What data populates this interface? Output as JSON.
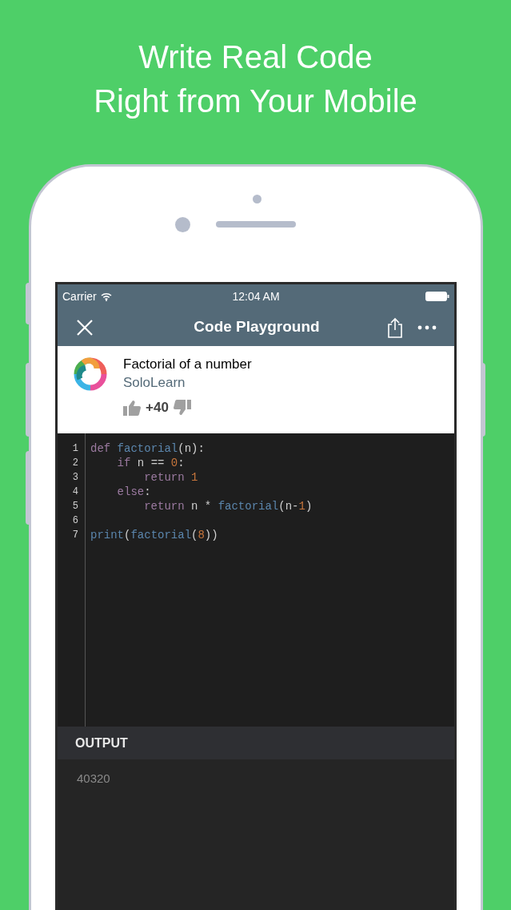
{
  "headline": [
    "Write Real Code",
    "Right from Your Mobile"
  ],
  "status_bar": {
    "carrier": "Carrier",
    "time": "12:04 AM"
  },
  "nav": {
    "title": "Code Playground"
  },
  "code_info": {
    "title": "Factorial of a number",
    "author": "SoloLearn",
    "votes": "+40"
  },
  "editor": {
    "lines": [
      {
        "number": "1",
        "tokens": [
          {
            "text": "def",
            "kind": "keyword"
          },
          {
            "text": " factorial",
            "kind": "function"
          },
          {
            "text": "(n):",
            "kind": "plain"
          }
        ]
      },
      {
        "number": "2",
        "tokens": [
          {
            "text": "    if",
            "kind": "keyword"
          },
          {
            "text": " n == ",
            "kind": "plain"
          },
          {
            "text": "0",
            "kind": "number"
          },
          {
            "text": ":",
            "kind": "plain"
          }
        ]
      },
      {
        "number": "3",
        "tokens": [
          {
            "text": "        return",
            "kind": "keyword"
          },
          {
            "text": " 1",
            "kind": "number"
          }
        ]
      },
      {
        "number": "4",
        "tokens": [
          {
            "text": "    else",
            "kind": "keyword"
          },
          {
            "text": ":",
            "kind": "plain"
          }
        ]
      },
      {
        "number": "5",
        "tokens": [
          {
            "text": "        return",
            "kind": "keyword"
          },
          {
            "text": " n * ",
            "kind": "plain"
          },
          {
            "text": "factorial",
            "kind": "function"
          },
          {
            "text": "(n-",
            "kind": "plain"
          },
          {
            "text": "1",
            "kind": "number"
          },
          {
            "text": ")",
            "kind": "plain"
          }
        ]
      },
      {
        "number": "6"
      },
      {
        "number": "7",
        "tokens": [
          {
            "text": "print",
            "kind": "function"
          },
          {
            "text": "(",
            "kind": "plain"
          },
          {
            "text": "factorial",
            "kind": "function"
          },
          {
            "text": "(",
            "kind": "plain"
          },
          {
            "text": "8",
            "kind": "number"
          },
          {
            "text": "))",
            "kind": "plain"
          }
        ]
      }
    ]
  },
  "output": {
    "heading": "OUTPUT",
    "text": "40320"
  }
}
